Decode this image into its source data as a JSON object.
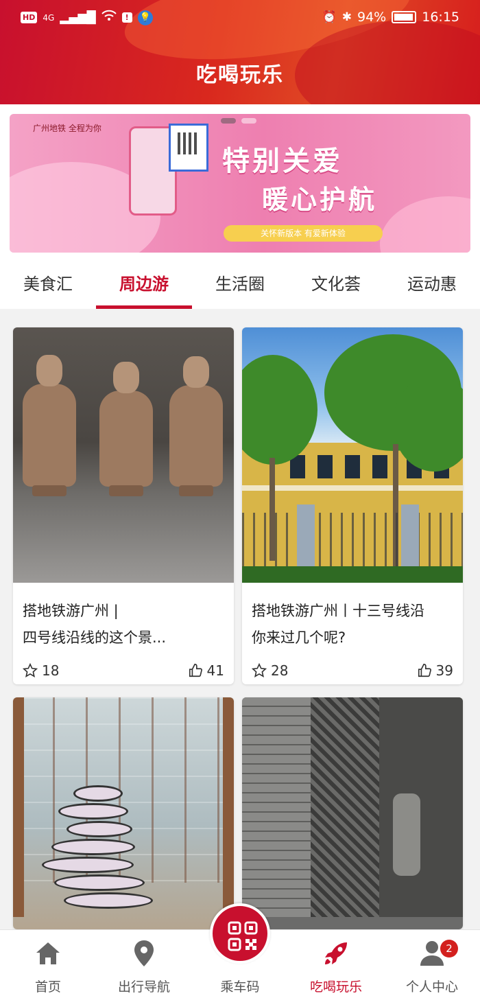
{
  "status_bar": {
    "left_badges": [
      "HD",
      "4G"
    ],
    "battery_percent": "94%",
    "time": "16:15"
  },
  "header": {
    "title": "吃喝玩乐"
  },
  "banner": {
    "brand": "广州地铁 全程为你",
    "headline_1": "特别关爱",
    "headline_2": "暖心护航",
    "pill_text": "关怀新版本 有爱新体验",
    "slides": 2,
    "active_slide": 1
  },
  "tabs": [
    {
      "label": "美食汇"
    },
    {
      "label": "周边游"
    },
    {
      "label": "生活圈"
    },
    {
      "label": "文化荟"
    },
    {
      "label": "运动惠"
    }
  ],
  "active_tab": 1,
  "cards": [
    {
      "line1": "搭地铁游广州 |",
      "line2": "四号线沿线的这个景...",
      "stars": "18",
      "likes": "41",
      "image": "clay-figurines"
    },
    {
      "line1": "搭地铁游广州丨十三号线沿",
      "line2": "你来过几个呢?",
      "stars": "28",
      "likes": "39",
      "image": "colonial-building"
    },
    {
      "image": "atrium-film-sculpture"
    },
    {
      "image": "stone-carving"
    }
  ],
  "bottom_nav": [
    {
      "label": "首页",
      "icon": "home-icon"
    },
    {
      "label": "出行导航",
      "icon": "location-pin-icon"
    },
    {
      "label": "乘车码",
      "icon": "qr-code-icon"
    },
    {
      "label": "吃喝玩乐",
      "icon": "rocket-icon"
    },
    {
      "label": "个人中心",
      "icon": "person-icon",
      "badge": "2"
    }
  ],
  "colors": {
    "brand": "#c8102e",
    "header_bg": "#d9281e",
    "banner_bg": "#ee7fb0"
  }
}
